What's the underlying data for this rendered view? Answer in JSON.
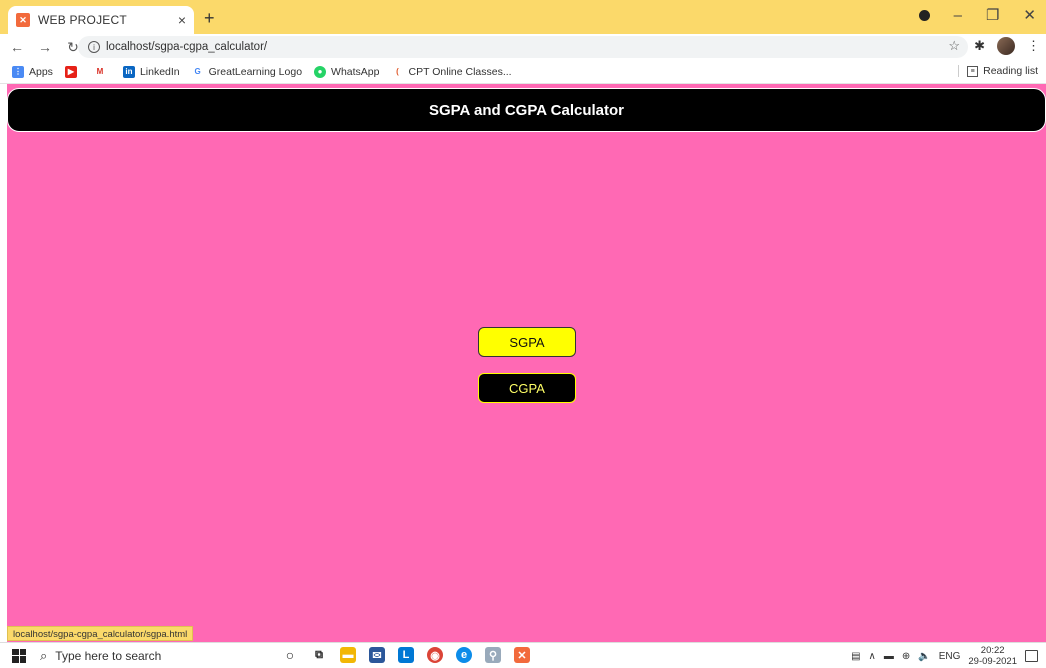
{
  "browser": {
    "tab_title": "WEB PROJECT",
    "tab_close": "×",
    "new_tab": "+",
    "url": "localhost/sgpa-cgpa_calculator/",
    "bookmarks": [
      "Apps",
      "LinkedIn",
      "GreatLearning Logo",
      "WhatsApp",
      "CPT Online Classes..."
    ],
    "reading_list": "Reading list",
    "status_url": "localhost/sgpa-cgpa_calculator/sgpa.html"
  },
  "page": {
    "title": "SGPA and CGPA Calculator",
    "buttons": {
      "sgpa": "SGPA",
      "cgpa": "CGPA"
    },
    "colors": {
      "background": "#ff69b4",
      "header": "#000000",
      "sgpa_button": "#ffff00",
      "cgpa_button": "#000000"
    }
  },
  "taskbar": {
    "search_placeholder": "Type here to search",
    "language": "ENG",
    "time": "20:22",
    "date": "29-09-2021"
  }
}
